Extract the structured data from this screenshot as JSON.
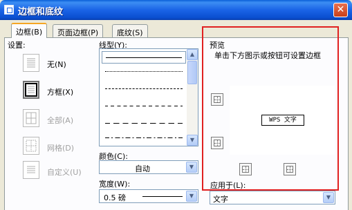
{
  "window": {
    "title": "边框和底纹",
    "close_glyph": "✕"
  },
  "tabs": [
    {
      "label": "边框(B)"
    },
    {
      "label": "页面边框(P)"
    },
    {
      "label": "底纹(S)"
    }
  ],
  "settings": {
    "heading": "设置:",
    "items": [
      {
        "label": "无(N)"
      },
      {
        "label": "方框(X)"
      },
      {
        "label": "全部(A)"
      },
      {
        "label": "网格(D)"
      },
      {
        "label": "自定义(U)"
      }
    ]
  },
  "line_style": {
    "label": "线型(Y):",
    "selected_index": 0,
    "styles": [
      "solid",
      "dotted-fine",
      "dashed-small",
      "dashed-medium",
      "dashed-large",
      "dash-dot"
    ]
  },
  "color": {
    "label": "颜色(C):",
    "value": "自动"
  },
  "width": {
    "label": "宽度(W):",
    "value": "0.5 磅"
  },
  "preview": {
    "label": "预览",
    "hint": "单击下方图示或按钮可设置边框",
    "sample_text": "WPS 文字",
    "highlight_color": "#e02020"
  },
  "apply_to": {
    "label": "应用于(L):",
    "value": "文字"
  },
  "glyphs": {
    "scroll_up": "▲",
    "scroll_down": "▼",
    "combo_arrow": "▼"
  }
}
